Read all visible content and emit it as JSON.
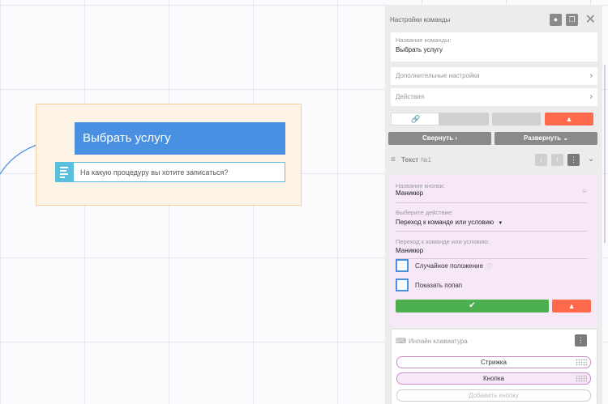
{
  "canvas": {
    "node": {
      "title": "Выбрать услугу",
      "message": "На какую процедуру вы хотите записаться?"
    }
  },
  "panel": {
    "title": "Настройки команды",
    "command_name": {
      "label": "Название команды:",
      "value": "Выбрать услугу"
    },
    "additional_settings": "Дополнительные настройки",
    "actions": "Действия",
    "collapse_button": "Свернуть",
    "expand_button": "Развернуть",
    "section": {
      "type": "Текст",
      "number": "№1"
    },
    "button_name": {
      "label": "Название кнопки:",
      "value": "Маникюр"
    },
    "choose_action": {
      "label": "Выберите действие:",
      "value": "Переход к команде или условию"
    },
    "goto_command": {
      "label": "Переход к команде или условию:",
      "value": "Маникюр"
    },
    "random_position": "Случайное положение",
    "show_popup": "Показать попап",
    "inline_keyboard": {
      "title": "Инлайн клавиатура",
      "buttons": [
        "Стрижка",
        "Кнопка"
      ],
      "add_button": "Добавить кнопку"
    }
  },
  "colors": {
    "primary": "#4a90e2",
    "success": "#4caf50",
    "danger": "#ff6a4d",
    "info": "#5bc0de"
  }
}
